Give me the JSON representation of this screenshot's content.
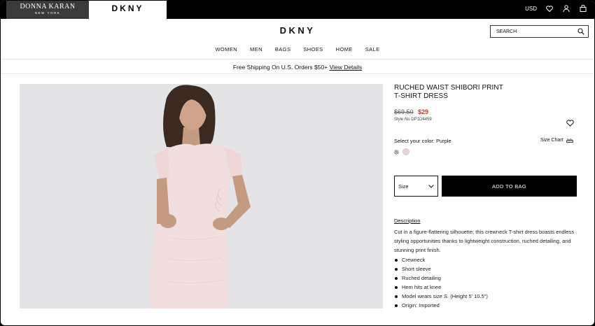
{
  "brand": {
    "donnakaran_line1": "DONNA KARAN",
    "donnakaran_line2": "NEW YORK",
    "dkny_tab": "DKNY",
    "logo": "DKNY"
  },
  "topbar": {
    "currency": "USD",
    "icons": [
      "heart-icon",
      "user-icon",
      "bag-icon"
    ]
  },
  "search": {
    "placeholder": "SEARCH"
  },
  "nav": [
    "WOMEN",
    "MEN",
    "BAGS",
    "SHOES",
    "HOME",
    "SALE"
  ],
  "banner": {
    "text": "Free Shipping On U.S. Orders $50+",
    "link": "View Details"
  },
  "product": {
    "title_line1": "RUCHED WAIST SHIBORI PRINT",
    "title_line2": "T-SHIRT DRESS",
    "price_original": "$69.50",
    "price_sale": "$29",
    "style_no": "Style No DP1D4459",
    "color_label": "Select your color: Purple",
    "size_chart": "Size Chart",
    "size_select": "Size",
    "add_to_bag": "ADD TO BAG",
    "description_title": "Description",
    "description": "Cut in a figure-flattering silhouette; this crewneck T-shirt dress boasts endless styling opportunities thanks to lightweight construction, ruched detailing, and stunning print finish.",
    "features": [
      "Crewneck",
      "Short sleeve",
      "Ruched detailing",
      "Hem hits at knee",
      "Model wears size S. (Height 5' 10.5\")",
      "Origin: Imported"
    ]
  },
  "colors": {
    "sale": "#c0392b",
    "button": "#000000",
    "swatch": "#e9d4d4"
  }
}
